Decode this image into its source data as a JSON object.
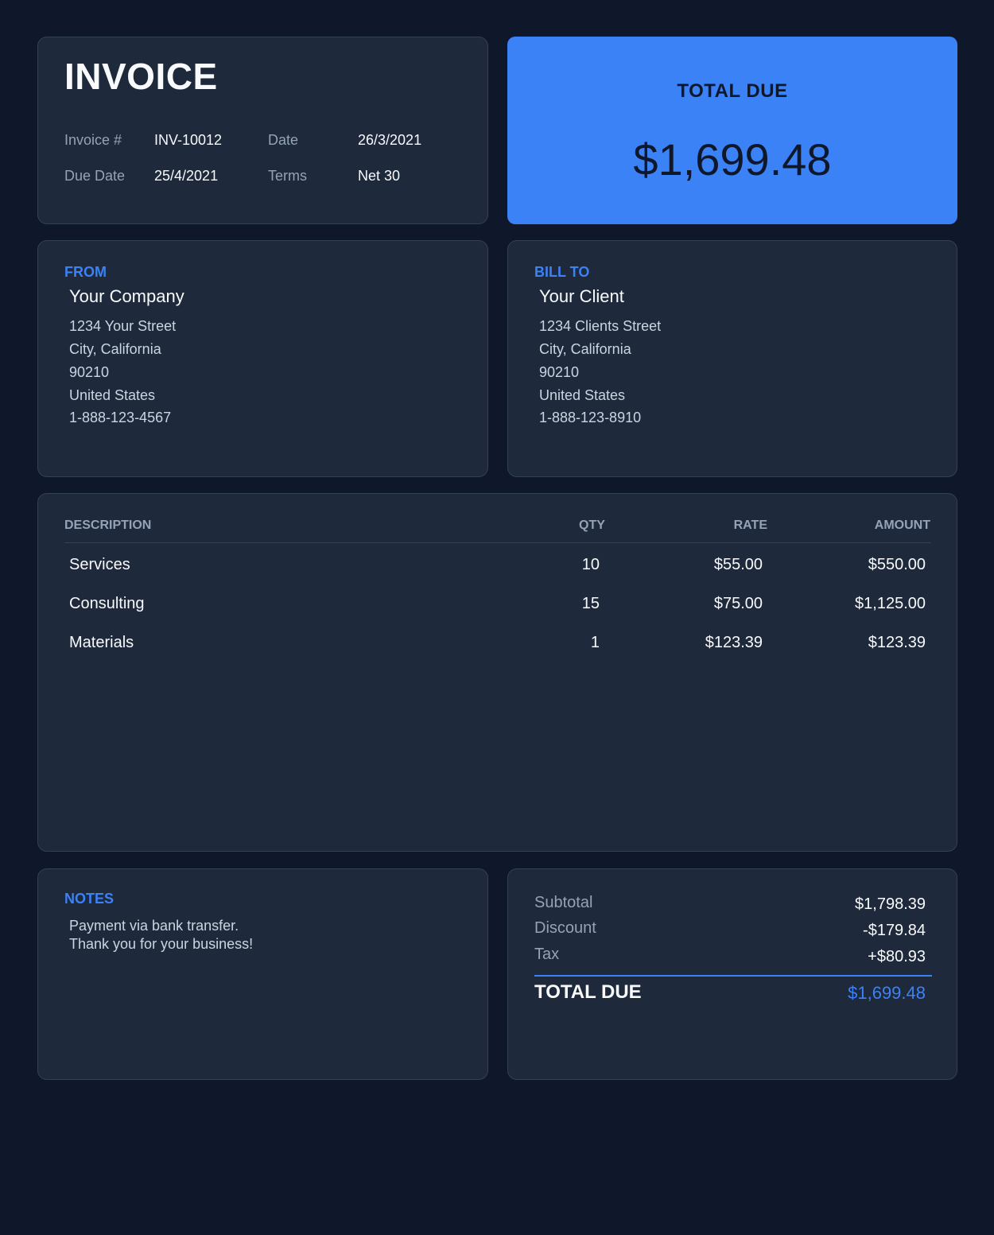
{
  "header": {
    "title": "INVOICE",
    "invoice_number_label": "Invoice #",
    "invoice_number": "INV-10012",
    "date_label": "Date",
    "date": "26/3/2021",
    "due_date_label": "Due Date",
    "due_date": "25/4/2021",
    "terms_label": "Terms",
    "terms": "Net 30"
  },
  "total_panel": {
    "label": "TOTAL DUE",
    "amount": "$1,699.48"
  },
  "from": {
    "label": "FROM",
    "name": "Your Company",
    "lines": [
      "1234 Your Street",
      "City, California",
      "90210",
      "United States",
      "1-888-123-4567"
    ]
  },
  "bill_to": {
    "label": "BILL TO",
    "name": "Your Client",
    "lines": [
      "1234 Clients Street",
      "City, California",
      "90210",
      "United States",
      "1-888-123-8910"
    ]
  },
  "items": {
    "columns": {
      "description": "DESCRIPTION",
      "qty": "QTY",
      "rate": "RATE",
      "amount": "AMOUNT"
    },
    "rows": [
      {
        "description": "Services",
        "qty": "10",
        "rate": "$55.00",
        "amount": "$550.00"
      },
      {
        "description": "Consulting",
        "qty": "15",
        "rate": "$75.00",
        "amount": "$1,125.00"
      },
      {
        "description": "Materials",
        "qty": "1",
        "rate": "$123.39",
        "amount": "$123.39"
      }
    ]
  },
  "notes": {
    "label": "NOTES",
    "lines": [
      "Payment via bank transfer.",
      "Thank you for your business!"
    ]
  },
  "summary": {
    "subtotal_label": "Subtotal",
    "subtotal": "$1,798.39",
    "discount_label": "Discount",
    "discount": "-$179.84",
    "tax_label": "Tax",
    "tax": "+$80.93",
    "total_label": "TOTAL DUE",
    "total": "$1,699.48"
  },
  "colors": {
    "background": "#0f172a",
    "card": "#1e293b",
    "accent": "#3b82f6"
  }
}
